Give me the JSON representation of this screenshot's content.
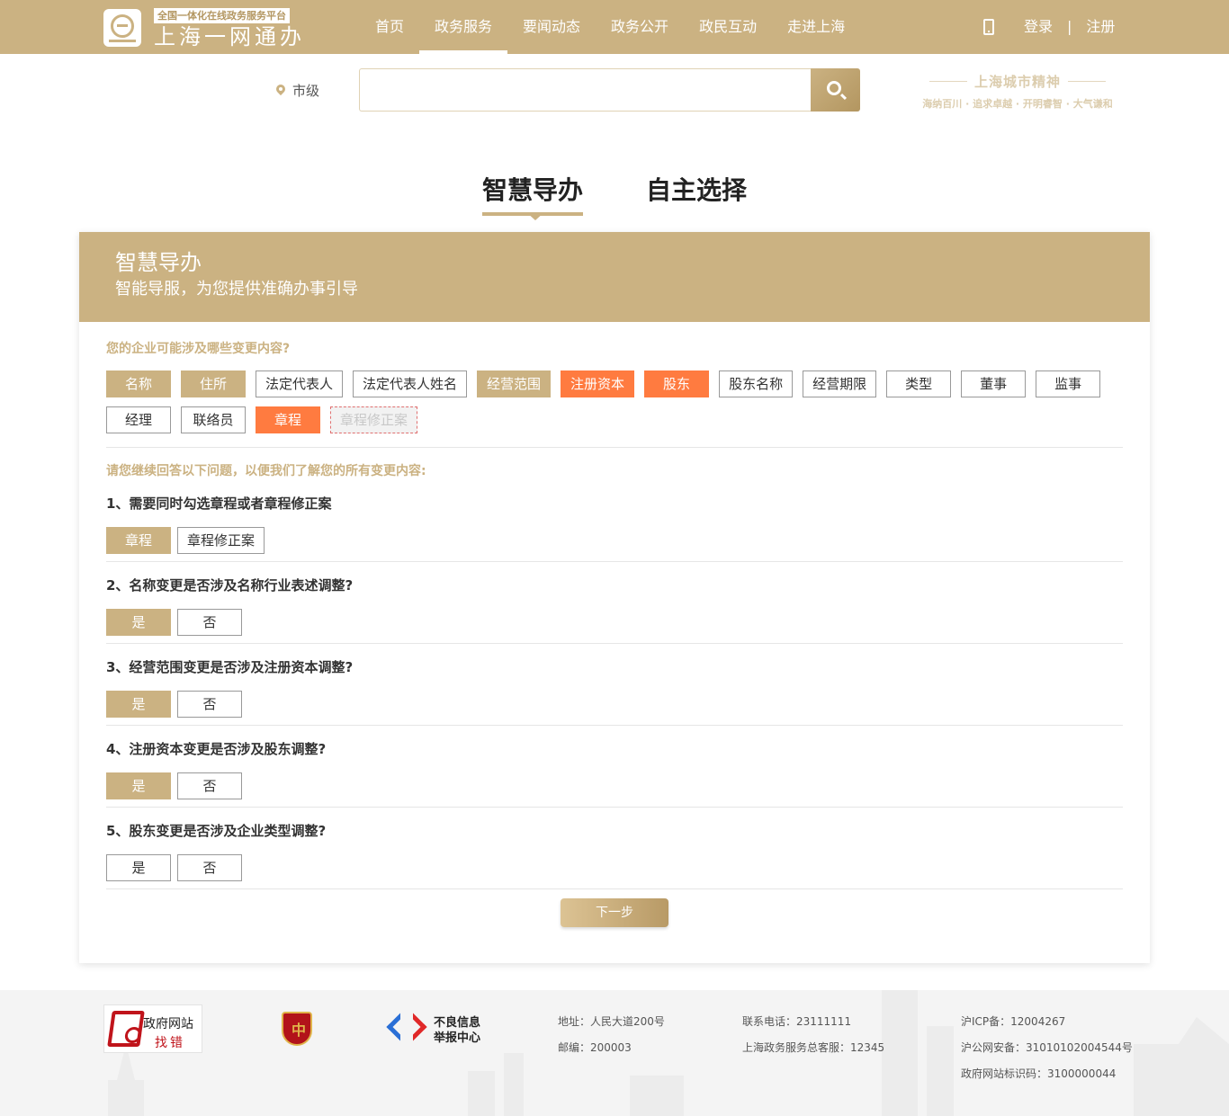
{
  "header": {
    "logo_tag": "全国一体化在线政务服务平台",
    "logo_text": "上海一网通办",
    "nav": [
      "首页",
      "政务服务",
      "要闻动态",
      "政务公开",
      "政民互动",
      "走进上海"
    ],
    "nav_active": "政务服务",
    "login": "登录",
    "separator": "|",
    "register": "注册"
  },
  "search": {
    "location": "市级",
    "placeholder": "",
    "slogan_title": "上海城市精神",
    "slogan_sub": "海纳百川 · 追求卓越 · 开明睿智 · 大气谦和"
  },
  "mode_tabs": {
    "active": "智慧导办",
    "other": "自主选择"
  },
  "panel": {
    "title": "智慧导办",
    "subtitle": "智能导服，为您提供准确办事引导",
    "intro": "您的企业可能涉及哪些变更内容?",
    "tags": [
      {
        "label": "名称",
        "state": "gold"
      },
      {
        "label": "住所",
        "state": "gold"
      },
      {
        "label": "法定代表人",
        "state": "normal"
      },
      {
        "label": "法定代表人姓名",
        "state": "normal"
      },
      {
        "label": "经营范围",
        "state": "gold"
      },
      {
        "label": "注册资本",
        "state": "orange"
      },
      {
        "label": "股东",
        "state": "orange"
      },
      {
        "label": "股东名称",
        "state": "normal"
      },
      {
        "label": "经营期限",
        "state": "normal"
      },
      {
        "label": "类型",
        "state": "normal"
      },
      {
        "label": "董事",
        "state": "normal"
      },
      {
        "label": "监事",
        "state": "normal"
      },
      {
        "label": "经理",
        "state": "normal"
      },
      {
        "label": "联络员",
        "state": "normal"
      },
      {
        "label": "章程",
        "state": "orange"
      },
      {
        "label": "章程修正案",
        "state": "disabled"
      }
    ],
    "follow_up": "请您继续回答以下问题，以便我们了解您的所有变更内容:",
    "questions": [
      {
        "text": "1、需要同时勾选章程或者章程修正案",
        "options": [
          {
            "label": "章程",
            "selected": true
          },
          {
            "label": "章程修正案",
            "selected": false
          }
        ]
      },
      {
        "text": "2、名称变更是否涉及名称行业表述调整?",
        "options": [
          {
            "label": "是",
            "selected": true
          },
          {
            "label": "否",
            "selected": false
          }
        ]
      },
      {
        "text": "3、经营范围变更是否涉及注册资本调整?",
        "options": [
          {
            "label": "是",
            "selected": true
          },
          {
            "label": "否",
            "selected": false
          }
        ]
      },
      {
        "text": "4、注册资本变更是否涉及股东调整?",
        "options": [
          {
            "label": "是",
            "selected": true
          },
          {
            "label": "否",
            "selected": false
          }
        ]
      },
      {
        "text": "5、股东变更是否涉及企业类型调整?",
        "options": [
          {
            "label": "是",
            "selected": false
          },
          {
            "label": "否",
            "selected": false
          }
        ]
      }
    ],
    "next_label": "下一步"
  },
  "footer": {
    "logo1_line1": "政府网站",
    "logo1_line2": "找错",
    "logo2_char": "中",
    "logo3_line1": "不良信息",
    "logo3_line2": "举报中心",
    "address": "地址：人民大道200号",
    "postcode": "邮编：200003",
    "phone": "联系电话：23111111",
    "hotline": "上海政务服务总客服：12345",
    "icp": "沪ICP备：12004267",
    "police": "沪公网安备：31010102004544号",
    "site_id": "政府网站标识码：3100000044"
  },
  "colors": {
    "brand": "#cbb282",
    "highlight": "#ff7b40"
  }
}
